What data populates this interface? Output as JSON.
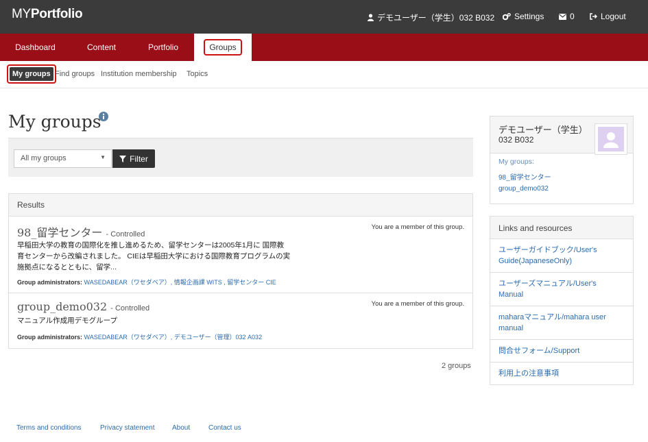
{
  "header": {
    "logo_my": "MY",
    "logo_portfolio": "Portfolio",
    "user": "デモユーザー（学生）032 B032",
    "settings": "Settings",
    "inbox_count": "0",
    "logout": "Logout"
  },
  "mainnav": {
    "tabs": [
      {
        "label": "Dashboard"
      },
      {
        "label": "Content"
      },
      {
        "label": "Portfolio"
      },
      {
        "label": "Groups",
        "active": true
      }
    ]
  },
  "subnav": {
    "items": [
      {
        "label": "My groups",
        "active": true
      },
      {
        "label": "Find groups"
      },
      {
        "label": "Institution membership"
      },
      {
        "label": "Topics"
      }
    ]
  },
  "page": {
    "title": "My groups"
  },
  "filter": {
    "select_value": "All my groups",
    "button_label": "Filter"
  },
  "results": {
    "heading": "Results",
    "groups": [
      {
        "name": "98_留学センター",
        "type": "- Controlled",
        "membership": "You are a member of this group.",
        "description_lines": [
          "早稲田大学の教育の国際化を推し進めるため、留学センターは2005年1月に 国際教",
          "育センターから改編されました。 CIEは早稲田大学における国際教育プログラムの実",
          "施拠点になるとともに、留学..."
        ],
        "admins_label": "Group administrators:",
        "admins": "WASEDABEAR（ワセダベア）, 情報企画課 WITS , 留学センター CIE"
      },
      {
        "name": "group_demo032",
        "type": "- Controlled",
        "membership": "You are a member of this group.",
        "description_lines": [
          "マニュアル作成用デモグループ"
        ],
        "admins_label": "Group administrators:",
        "admins": "WASEDABEAR（ワセダベア）, デモユーザー（管理）032 A032"
      }
    ],
    "count": "2 groups"
  },
  "sidebar": {
    "user": {
      "name": "デモユーザー（学生）",
      "id": "032 B032",
      "groups_label": "My groups:",
      "groups": [
        "98_留学センター",
        "group_demo032"
      ]
    },
    "links": {
      "heading": "Links and resources",
      "items": [
        {
          "lines": [
            "ユーザーガイドブック/User's",
            "Guide(JapaneseOnly)"
          ]
        },
        {
          "lines": [
            "ユーザーズマニュアル/User's",
            "Manual"
          ]
        },
        {
          "lines": [
            "maharaマニュアル/mahara user",
            "manual"
          ]
        },
        {
          "lines": [
            "問合せフォーム/Support"
          ]
        },
        {
          "lines": [
            "利用上の注意事項"
          ]
        }
      ]
    }
  },
  "footer": {
    "links": [
      "Terms and conditions",
      "Privacy statement",
      "About",
      "Contact us"
    ]
  },
  "colors": {
    "header_bg": "#3b3b3b",
    "nav_bg": "#9a0e18",
    "highlight": "#cc1111",
    "link": "#2a6bb0"
  },
  "icons": [
    "user-icon",
    "gear-icon",
    "envelope-icon",
    "logout-icon",
    "info-icon",
    "filter-icon",
    "caret-down-icon",
    "avatar-placeholder-icon"
  ]
}
